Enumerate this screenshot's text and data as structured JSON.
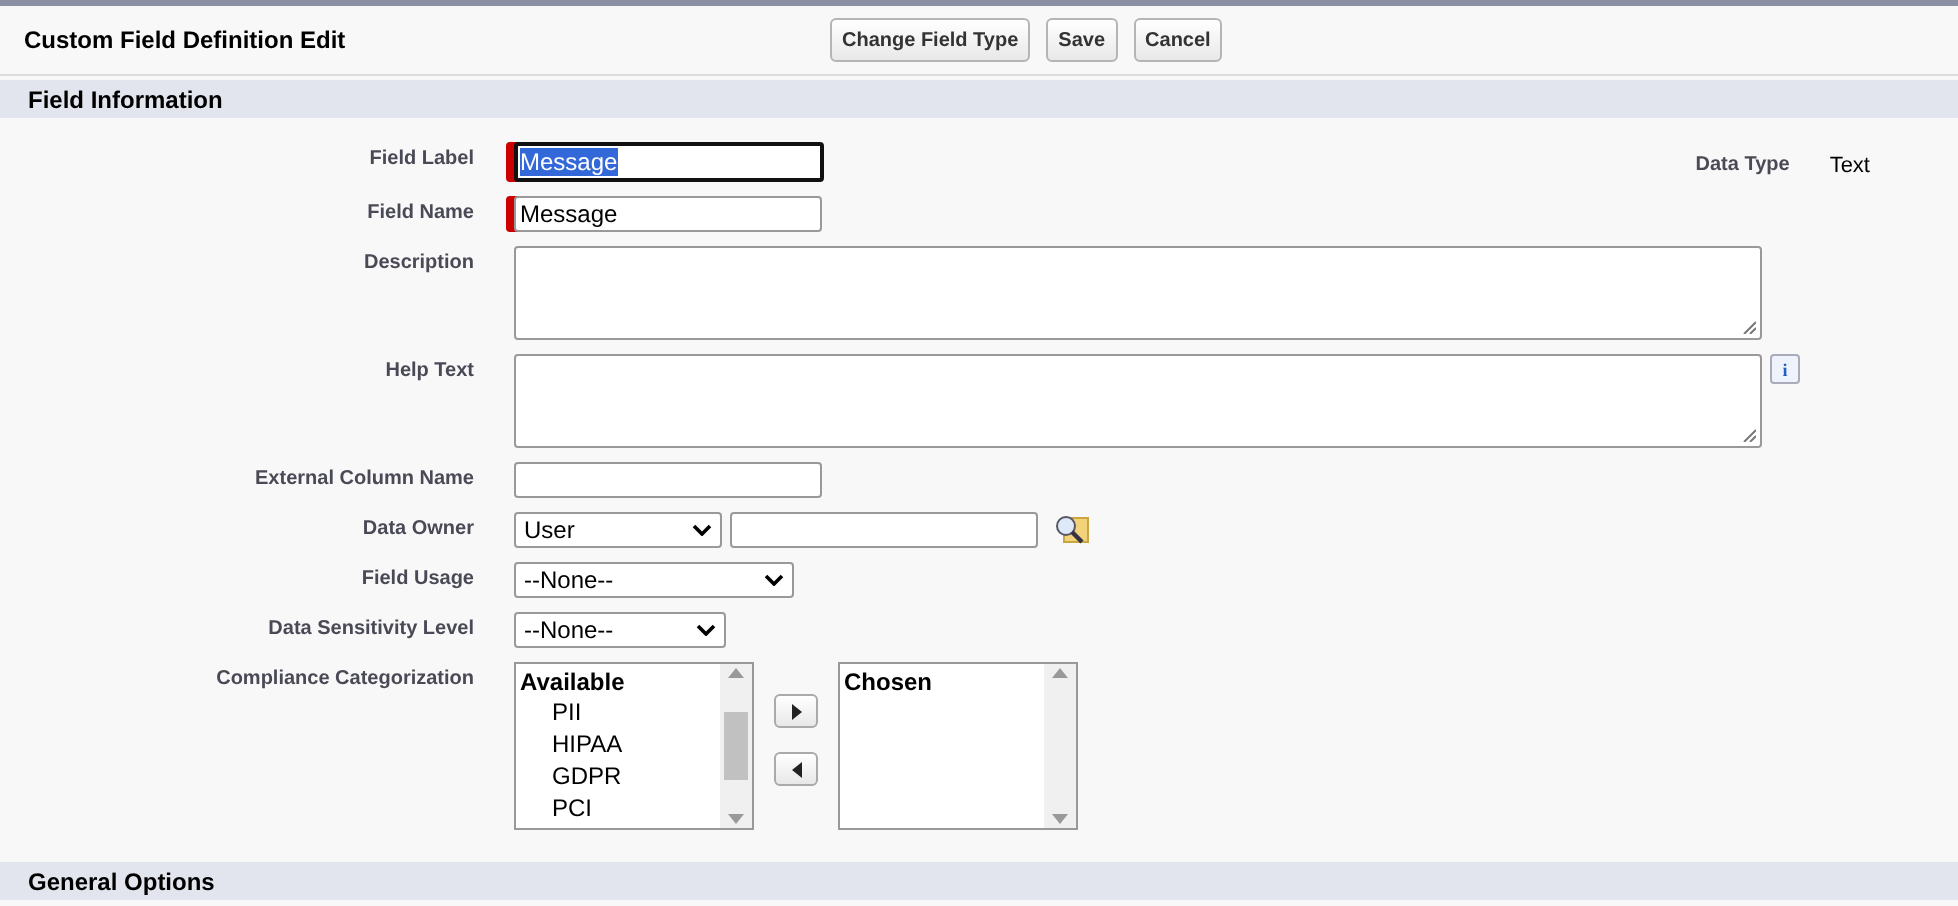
{
  "header": {
    "title": "Custom Field Definition Edit",
    "buttons": [
      "Change Field Type",
      "Save",
      "Cancel"
    ]
  },
  "section": {
    "title": "Field Information"
  },
  "data_type": {
    "label": "Data Type",
    "value": "Text"
  },
  "fields": [
    {
      "kind": "text",
      "label": "Field Label",
      "value": "Message",
      "required": true,
      "focused": true,
      "text_selected": true
    },
    {
      "kind": "text",
      "label": "Field Name",
      "value": "Message",
      "required": true,
      "focused": false,
      "text_selected": false
    },
    {
      "kind": "textarea",
      "label": "Description"
    },
    {
      "kind": "textarea",
      "label": "Help Text",
      "info_icon": "i"
    },
    {
      "kind": "text",
      "label": "External Column Name",
      "required": false,
      "focused": false
    },
    {
      "kind": "owner",
      "label": "Data Owner",
      "value": "User"
    },
    {
      "kind": "select",
      "label": "Field Usage",
      "value": "--None--",
      "wide": true
    },
    {
      "kind": "select",
      "label": "Data Sensitivity Level",
      "value": "--None--",
      "wide": false
    },
    {
      "kind": "multiselect",
      "label": "Compliance Categorization",
      "available": {
        "heading": "Available",
        "options": [
          "PII",
          "HIPAA",
          "GDPR",
          "PCI"
        ]
      },
      "chosen": {
        "heading": "Chosen"
      }
    }
  ],
  "next_section": {
    "title": "General Options"
  }
}
